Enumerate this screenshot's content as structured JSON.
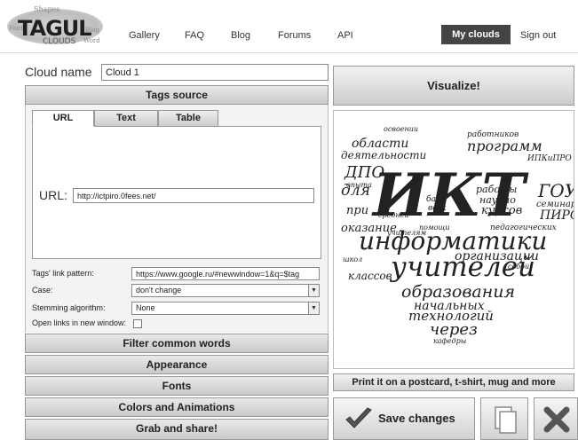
{
  "logo": {
    "brand": "TAGUL",
    "sub": "CLOUDS",
    "cloud_words": [
      "Shapes",
      "Blog",
      "Font",
      "Word"
    ]
  },
  "nav": {
    "items": [
      "Gallery",
      "FAQ",
      "Blog",
      "Forums",
      "API"
    ],
    "my_clouds": "My clouds",
    "sign_out": "Sign out"
  },
  "cloud_name": {
    "label": "Cloud name",
    "value": "Cloud 1"
  },
  "tags_source": {
    "title": "Tags source",
    "tabs": [
      "URL",
      "Text",
      "Table"
    ],
    "active_tab": "URL",
    "url_label": "URL:",
    "url_value": "http://ictpiro.0fees.net/"
  },
  "options": {
    "link_pattern_label": "Tags' link pattern:",
    "link_pattern_value": "https://www.google.ru/#newwindow=1&q=$tag",
    "case_label": "Case:",
    "case_value": "don't change",
    "stemming_label": "Stemming algorithm:",
    "stemming_value": "None",
    "new_window_label": "Open links in new window:",
    "new_window_checked": false
  },
  "sections": {
    "filter": "Filter common words",
    "appearance": "Appearance",
    "fonts": "Fonts",
    "colors": "Colors and Animations",
    "grab": "Grab and share!"
  },
  "actions": {
    "visualize": "Visualize!",
    "print": "Print it on a postcard, t-shirt, mug and more",
    "save": "Save changes"
  },
  "cloud_words": [
    "ИКТ",
    "информатики",
    "учителей",
    "образования",
    "технологий",
    "через",
    "программ",
    "области",
    "деятельности",
    "ДПО",
    "для",
    "при",
    "ГОУ",
    "ПИРО",
    "курсов",
    "оказание",
    "работы",
    "научно",
    "семинары",
    "организации",
    "начальных",
    "классов",
    "кафедры",
    "работников",
    "учителям",
    "педагогических",
    "помощи",
    "собой",
    "базе",
    "всех",
    "ИПКиПРО",
    "освоении",
    "опыта",
    "средней",
    "школ"
  ],
  "colors": {
    "nav_active_bg": "#444444",
    "cloud_words": "#222222"
  }
}
